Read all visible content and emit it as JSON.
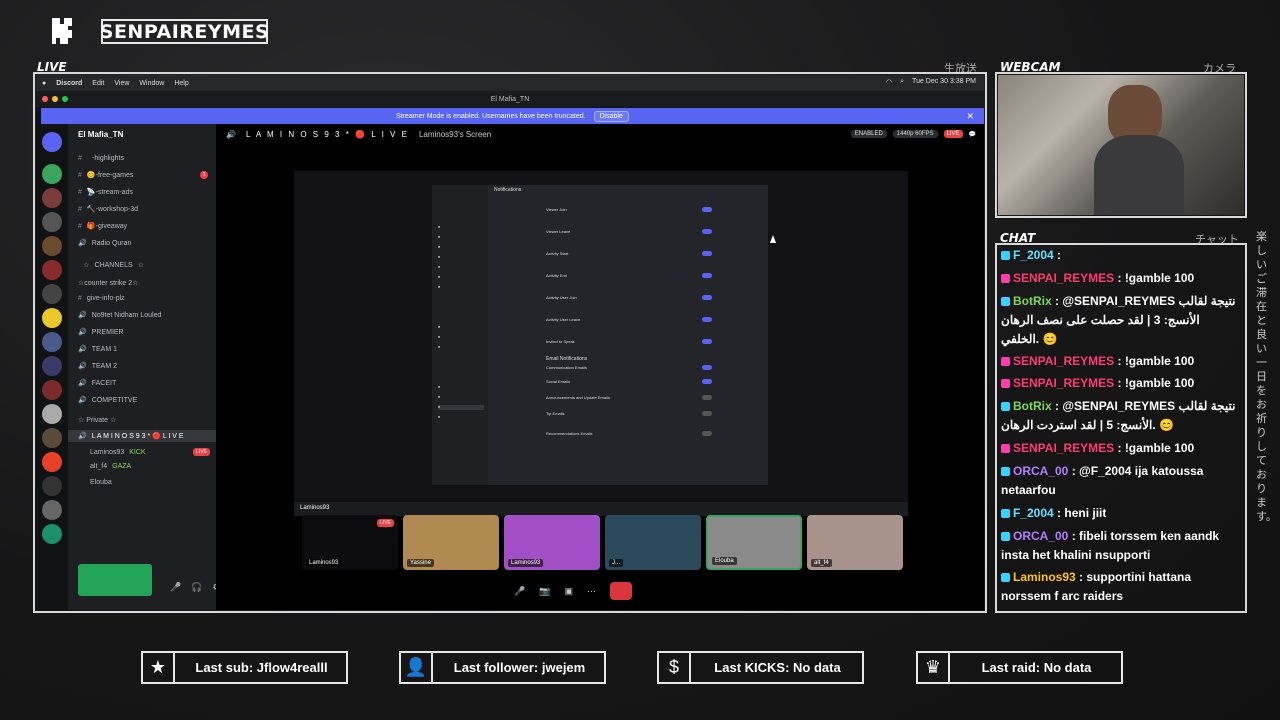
{
  "header": {
    "channel_name": "SENPAIREYMES"
  },
  "panels": {
    "live_label": "LIVE",
    "live_jp": "生放送",
    "webcam_label": "WEBCAM",
    "webcam_jp": "カメラ",
    "chat_label": "CHAT",
    "chat_jp": "チャット",
    "side_jp": "楽しいご滞在と良い一日をお祈りしております。"
  },
  "macos": {
    "menu": [
      "Discord",
      "Edit",
      "View",
      "Window",
      "Help"
    ],
    "clock": "Tue Dec 30  3:38 PM",
    "window_title": "El Mafia_TN"
  },
  "discord": {
    "banner_text": "Streamer Mode is enabled. Usernames have been truncated.",
    "banner_button": "Disable",
    "server_name": "El Mafia_TN",
    "channels": [
      {
        "name": "⠀-highlights",
        "type": "text"
      },
      {
        "name": "😊-free-games",
        "type": "text",
        "unread": "1"
      },
      {
        "name": "📡-stream-ads",
        "type": "text"
      },
      {
        "name": "🔨-workshop-3d",
        "type": "text"
      },
      {
        "name": "🎁-giveaway",
        "type": "text"
      },
      {
        "name": "Radio Quran",
        "type": "voice"
      },
      {
        "name": "⠀☆⠀CHANNELS⠀☆⠀",
        "type": "category"
      },
      {
        "name": "☆counter strike 2☆",
        "type": "category"
      },
      {
        "name": "give-info-plz",
        "type": "text"
      },
      {
        "name": "No9tet Nidham Louled",
        "type": "voice"
      },
      {
        "name": "PREMIER",
        "type": "voice"
      },
      {
        "name": "TEAM 1",
        "type": "voice"
      },
      {
        "name": "TEAM 2",
        "type": "voice"
      },
      {
        "name": "FACEIT",
        "type": "voice"
      },
      {
        "name": "COMPETITVE",
        "type": "voice"
      },
      {
        "name": "☆ Private ☆",
        "type": "category"
      },
      {
        "name": "L A M I N O S 9 3 * 🔴 L I V E",
        "type": "voice",
        "active": true
      }
    ],
    "voice_users": [
      {
        "name": "Laminos93",
        "tag": "KICK",
        "live": "LIVE"
      },
      {
        "name": "alt_f4",
        "tag": "GAZA"
      },
      {
        "name": "Elouba",
        "tag": ""
      }
    ],
    "stage_title": "L A M I N O S 9 3 * 🔴 L I V E",
    "stage_sub": "Laminos93's Screen",
    "badge_enabled": "ENABLED",
    "badge_quality": "1440p 60FPS",
    "badge_live": "LIVE",
    "settings_title": "Notifications",
    "settings_rows": [
      "Viewer Join",
      "Viewer Leave",
      "Activity Start",
      "Activity End",
      "Activity User Join",
      "Activity User Leave",
      "Invited to Speak"
    ],
    "settings_section": "Email Notifications",
    "settings_rows2": [
      "Communication Emails",
      "Social Emails",
      "Announcements and Update Emails",
      "Tip Emails",
      "Recommendations Emails"
    ],
    "tiles": [
      {
        "name": "Laminos93",
        "live": "LIVE"
      },
      {
        "name": "Yassine"
      },
      {
        "name": "Laminos93"
      },
      {
        "name": "J..."
      },
      {
        "name": "Elouba"
      },
      {
        "name": "alt_f4"
      }
    ],
    "screen_tag": "Laminos93"
  },
  "chat": {
    "messages": [
      {
        "user": "F_2004",
        "text": "",
        "color": "#66e0ff"
      },
      {
        "user": "SENPAI_REYMES",
        "text": "!gamble 100",
        "color": "#ff3b70"
      },
      {
        "user": "BotRix",
        "text": "@SENPAI_REYMES نتيجة لقالب الأنسج: 3 | لقد حصلت على نصف الرهان الخلفي. 😊",
        "color": "#7dd957"
      },
      {
        "user": "SENPAI_REYMES",
        "text": "!gamble 100",
        "color": "#ff3b70"
      },
      {
        "user": "SENPAI_REYMES",
        "text": "!gamble 100",
        "color": "#ff3b70"
      },
      {
        "user": "BotRix",
        "text": "@SENPAI_REYMES نتيجة لقالب الأنسج: 5 | لقد استردت الرهان. 😊",
        "color": "#7dd957"
      },
      {
        "user": "SENPAI_REYMES",
        "text": "!gamble 100",
        "color": "#ff3b70"
      },
      {
        "user": "ORCA_00",
        "text": "@F_2004 ija katoussa netaarfou",
        "color": "#b57cff"
      },
      {
        "user": "F_2004",
        "text": "heni jiit",
        "color": "#66e0ff"
      },
      {
        "user": "ORCA_00",
        "text": "fibeli torssem ken aandk insta het khalini nsupporti",
        "color": "#b57cff"
      },
      {
        "user": "Laminos93",
        "text": "supportini hattana norssem f arc raiders",
        "color": "#ffc21a"
      }
    ]
  },
  "stats": {
    "last_sub": "Last sub: Jflow4realll",
    "last_follower": "Last follower: jwejem",
    "last_kicks": "Last KICKS: No data",
    "last_raid": "Last raid: No data"
  },
  "colors": {
    "discord_blurple": "#5865f2",
    "live_red": "#ed4245",
    "frame": "#d8d8d8"
  }
}
